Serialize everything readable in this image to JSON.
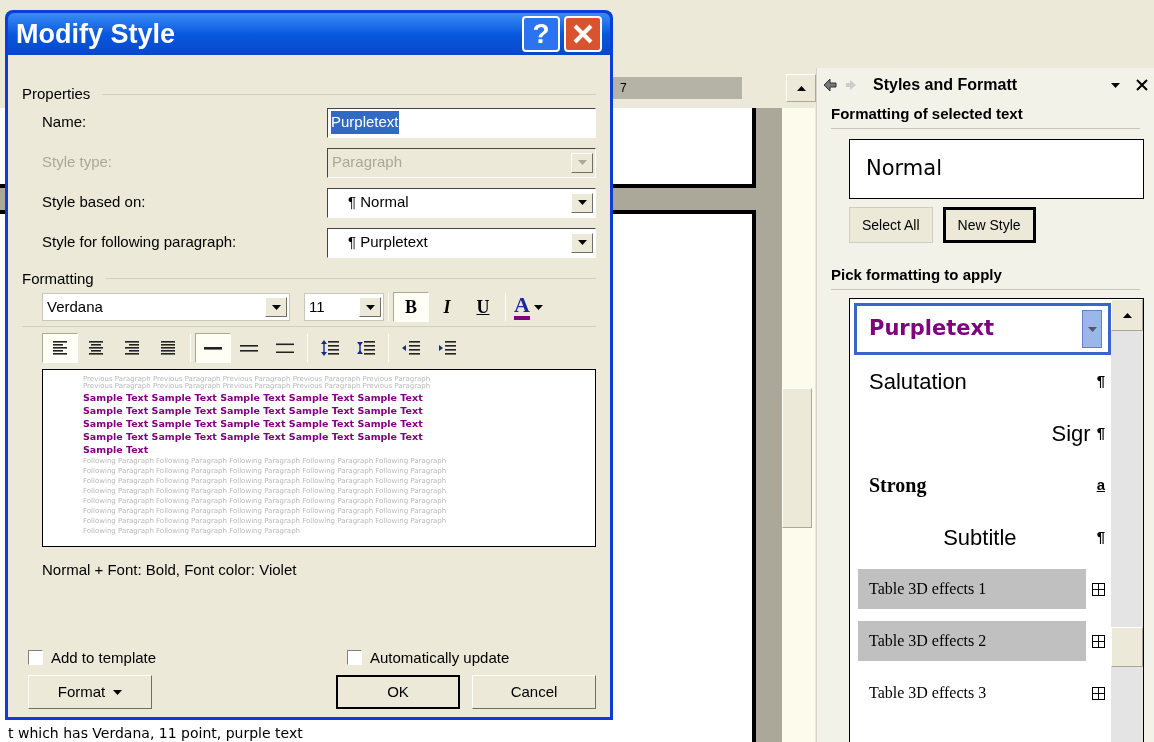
{
  "document": {
    "ruler_mark": "7",
    "caption": "t which has Verdana, 11 point, purple text"
  },
  "dialog": {
    "title": "Modify Style",
    "help_button": "?",
    "properties": {
      "heading": "Properties",
      "fields": [
        {
          "label": "Name:",
          "value": "Purpletext",
          "kind": "text",
          "disabled": false
        },
        {
          "label": "Style type:",
          "value": "Paragraph",
          "kind": "dropdown",
          "disabled": true
        },
        {
          "label": "Style based on:",
          "value": "¶ Normal",
          "kind": "dropdown",
          "disabled": false
        },
        {
          "label": "Style for following paragraph:",
          "value": "¶ Purpletext",
          "kind": "dropdown",
          "disabled": false
        }
      ]
    },
    "formatting": {
      "heading": "Formatting",
      "font": "Verdana",
      "size": "11",
      "style_buttons": [
        {
          "label": "B",
          "kind": "bold",
          "selected": true
        },
        {
          "label": "I",
          "kind": "italic",
          "selected": false
        },
        {
          "label": "U",
          "kind": "underline",
          "selected": false
        }
      ],
      "color_button": {
        "label": "A",
        "color": "#800080"
      },
      "align_buttons": [
        {
          "kind": "left",
          "selected": true
        },
        {
          "kind": "center",
          "selected": false
        },
        {
          "kind": "right",
          "selected": false
        },
        {
          "kind": "justify",
          "selected": false
        }
      ],
      "spacing_buttons": [
        {
          "kind": "single",
          "selected": true
        },
        {
          "kind": "one-half",
          "selected": false
        },
        {
          "kind": "double",
          "selected": false
        }
      ],
      "paragraph_buttons": [
        {
          "kind": "space-increase"
        },
        {
          "kind": "space-decrease"
        }
      ],
      "indent_buttons": [
        {
          "kind": "indent-decrease"
        },
        {
          "kind": "indent-increase"
        }
      ]
    },
    "preview": {
      "previous_lines": [
        "Previous Paragraph Previous Paragraph Previous Paragraph Previous Paragraph Previous Paragraph",
        "Previous Paragraph Previous Paragraph Previous Paragraph Previous Paragraph Previous Paragraph"
      ],
      "sample_lines": [
        "Sample Text Sample Text Sample Text Sample Text Sample Text",
        "Sample Text Sample Text Sample Text Sample Text Sample Text",
        "Sample Text Sample Text Sample Text Sample Text Sample Text",
        "Sample Text Sample Text Sample Text Sample Text Sample Text",
        "Sample Text"
      ],
      "following_lines": [
        "Following Paragraph Following Paragraph Following Paragraph Following Paragraph Following Paragraph",
        "Following Paragraph Following Paragraph Following Paragraph Following Paragraph Following Paragraph",
        "Following Paragraph Following Paragraph Following Paragraph Following Paragraph Following Paragraph",
        "Following Paragraph Following Paragraph Following Paragraph Following Paragraph Following Paragraph",
        "Following Paragraph Following Paragraph Following Paragraph Following Paragraph Following Paragraph",
        "Following Paragraph Following Paragraph Following Paragraph Following Paragraph Following Paragraph",
        "Following Paragraph Following Paragraph Following Paragraph Following Paragraph Following Paragraph",
        "Following Paragraph Following Paragraph Following Paragraph"
      ]
    },
    "description": "Normal + Font: Bold, Font color: Violet",
    "checkboxes": [
      {
        "label": "Add to template",
        "checked": false
      },
      {
        "label": "Automatically update",
        "checked": false
      }
    ],
    "format_button": "Format",
    "buttons": [
      {
        "label": "OK",
        "default": true
      },
      {
        "label": "Cancel",
        "default": false
      }
    ]
  },
  "task_pane": {
    "title": "Styles and Formatt",
    "selected_heading": "Formatting of selected text",
    "current_style": "Normal",
    "buttons": [
      {
        "label": "Select All",
        "default": false
      },
      {
        "label": "New Style",
        "default": true
      }
    ],
    "pick_heading": "Pick formatting to apply",
    "styles": [
      {
        "name": "Purpletext",
        "kind": "purple",
        "selected": true,
        "highlighted": false
      },
      {
        "name": "Salutation",
        "kind": "plain",
        "mark": "¶",
        "selected": false,
        "highlighted": false
      },
      {
        "name": "Sigr",
        "kind": "right",
        "mark": "¶",
        "selected": false,
        "highlighted": false
      },
      {
        "name": "Strong",
        "kind": "strong",
        "mark": "a",
        "selected": false,
        "highlighted": false
      },
      {
        "name": "Subtitle",
        "kind": "centered",
        "mark": "¶",
        "selected": false,
        "highlighted": false
      },
      {
        "name": "Table 3D effects 1",
        "kind": "table",
        "selected": false,
        "highlighted": true
      },
      {
        "name": "Table 3D effects 2",
        "kind": "table",
        "selected": false,
        "highlighted": true
      },
      {
        "name": "Table 3D effects 3",
        "kind": "table",
        "selected": false,
        "highlighted": false
      }
    ]
  }
}
